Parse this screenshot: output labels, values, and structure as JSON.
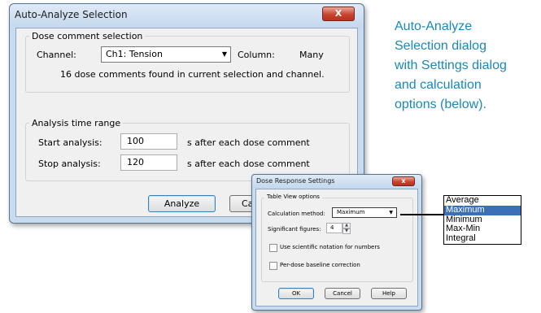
{
  "main_dialog": {
    "title": "Auto-Analyze Selection",
    "close_glyph": "X",
    "dose_group_title": "Dose comment selection",
    "channel_label": "Channel:",
    "channel_value": "Ch1: Tension",
    "column_label": "Column:",
    "column_value": "Many",
    "found_text": "16 dose comments found in current selection and channel.",
    "time_group_title": "Analysis time range",
    "start_label": "Start analysis:",
    "start_value": "100",
    "start_suffix": "s  after each dose comment",
    "stop_label": "Stop analysis:",
    "stop_value": "120",
    "stop_suffix": "s  after each dose comment",
    "analyze_button": "Analyze",
    "cancel_button_partial": "Car"
  },
  "caption": {
    "lines": [
      "Auto-Analyze",
      "Selection dialog",
      "with Settings dialog",
      "and calculation",
      "options (below)."
    ]
  },
  "settings_dialog": {
    "title": "Dose Response Settings",
    "close_glyph": "x",
    "group_title": "Table View options",
    "calc_label": "Calculation method:",
    "calc_value": "Maximum",
    "sig_label": "Significant figures:",
    "sig_value": "4",
    "sci_notation_label": "Use scientific notation for numbers",
    "sci_notation_checked": false,
    "baseline_label": "Per-dose baseline correction",
    "baseline_checked": false,
    "ok_button": "OK",
    "cancel_button": "Cancel",
    "help_button": "Help"
  },
  "calculation_options": {
    "items": [
      "Average",
      "Maximum",
      "Minimum",
      "Max-Min",
      "Integral"
    ],
    "selected": "Maximum"
  },
  "colors": {
    "caption": "#1b88b8",
    "selection": "#3c6fb6",
    "close_button": "#c7452f"
  }
}
